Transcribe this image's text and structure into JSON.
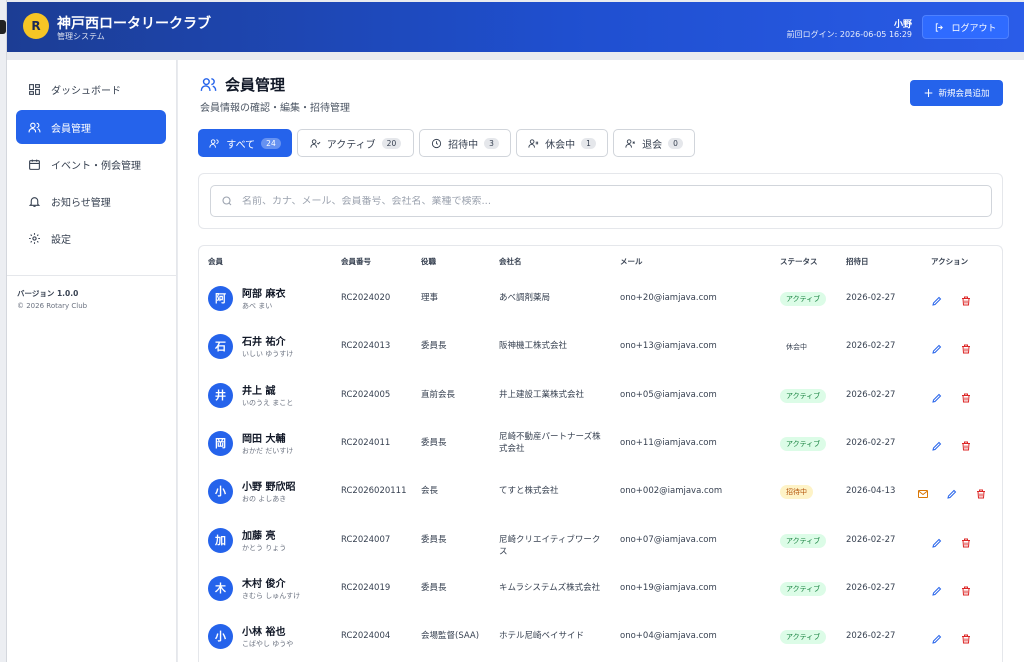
{
  "header": {
    "logo_letter": "R",
    "title": "神戸西ロータリークラブ",
    "subtitle": "管理システム",
    "user_name": "小野",
    "last_login": "前回ログイン: 2026-06-05 16:29",
    "logout_label": "ログアウト"
  },
  "sidebar": {
    "items": [
      {
        "label": "ダッシュボード",
        "icon": "dashboard-icon"
      },
      {
        "label": "会員管理",
        "icon": "users-icon",
        "active": true
      },
      {
        "label": "イベント・例会管理",
        "icon": "calendar-icon"
      },
      {
        "label": "お知らせ管理",
        "icon": "bell-icon"
      },
      {
        "label": "設定",
        "icon": "gear-icon"
      }
    ],
    "version": "バージョン 1.0.0",
    "copyright": "© 2026 Rotary Club"
  },
  "main": {
    "title": "会員管理",
    "subtitle": "会員情報の確認・編集・招待管理",
    "add_button": "新規会員追加",
    "tabs": [
      {
        "label": "すべて",
        "count": "24",
        "active": true
      },
      {
        "label": "アクティブ",
        "count": "20"
      },
      {
        "label": "招待中",
        "count": "3"
      },
      {
        "label": "休会中",
        "count": "1"
      },
      {
        "label": "退会",
        "count": "0"
      }
    ],
    "search_placeholder": "名前、カナ、メール、会員番号、会社名、業種で検索...",
    "columns": [
      "会員",
      "会員番号",
      "役職",
      "会社名",
      "メール",
      "ステータス",
      "招待日",
      "アクション"
    ],
    "rows": [
      {
        "avatar": "阿",
        "name": "阿部 麻衣",
        "kana": "あべ まい",
        "number": "RC2024020",
        "role": "理事",
        "company": "あべ調剤薬局",
        "email": "ono+20@iamjava.com",
        "status": "アクティブ",
        "date": "2026-02-27"
      },
      {
        "avatar": "石",
        "name": "石井 祐介",
        "kana": "いしい ゆうすけ",
        "number": "RC2024013",
        "role": "委員長",
        "company": "阪神機工株式会社",
        "email": "ono+13@iamjava.com",
        "status": "休会中",
        "date": "2026-02-27"
      },
      {
        "avatar": "井",
        "name": "井上 誠",
        "kana": "いのうえ まこと",
        "number": "RC2024005",
        "role": "直前会長",
        "company": "井上建設工業株式会社",
        "email": "ono+05@iamjava.com",
        "status": "アクティブ",
        "date": "2026-02-27"
      },
      {
        "avatar": "岡",
        "name": "岡田 大輔",
        "kana": "おかだ だいすけ",
        "number": "RC2024011",
        "role": "委員長",
        "company": "尼崎不動産パートナーズ株式会社",
        "email": "ono+11@iamjava.com",
        "status": "アクティブ",
        "date": "2026-02-27"
      },
      {
        "avatar": "小",
        "name": "小野 野欣昭",
        "kana": "おの よしあき",
        "number": "RC2026020111",
        "role": "会長",
        "company": "てすと株式会社",
        "email": "ono+002@iamjava.com",
        "status": "招待中",
        "date": "2026-04-13"
      },
      {
        "avatar": "加",
        "name": "加藤 亮",
        "kana": "かとう りょう",
        "number": "RC2024007",
        "role": "委員長",
        "company": "尼崎クリエイティブワークス",
        "email": "ono+07@iamjava.com",
        "status": "アクティブ",
        "date": "2026-02-27"
      },
      {
        "avatar": "木",
        "name": "木村 俊介",
        "kana": "きむら しゅんすけ",
        "number": "RC2024019",
        "role": "委員長",
        "company": "キムラシステムズ株式会社",
        "email": "ono+19@iamjava.com",
        "status": "アクティブ",
        "date": "2026-02-27"
      },
      {
        "avatar": "小",
        "name": "小林 裕也",
        "kana": "こばやし ゆうや",
        "number": "RC2024004",
        "role": "会場監督(SAA)",
        "company": "ホテル尼崎ベイサイド",
        "email": "ono+04@iamjava.com",
        "status": "アクティブ",
        "date": "2026-02-27"
      }
    ]
  },
  "colors": {
    "primary": "#2563eb",
    "header_dark": "#1c3d94",
    "logo": "#f6c525",
    "active_status": "#15803d",
    "invite_status": "#b45309",
    "delete": "#dc2626",
    "mail": "#d97706"
  }
}
